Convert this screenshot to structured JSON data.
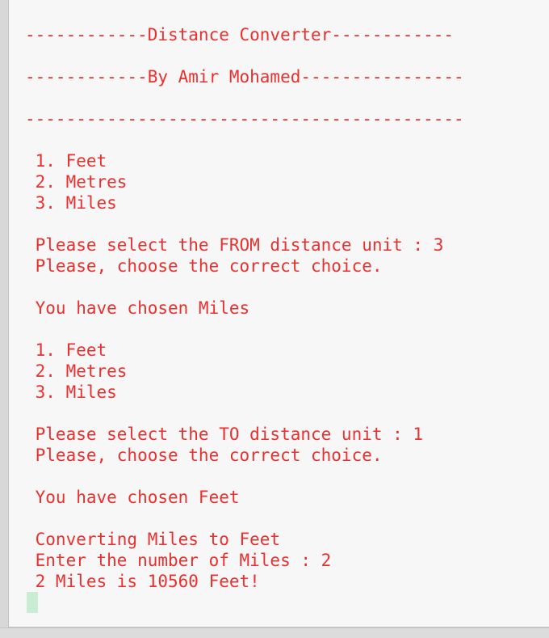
{
  "console": {
    "lines": [
      "------------Distance Converter------------",
      "------------By Amir Mohamed----------------",
      "-------------------------------------------",
      " 1. Feet",
      " 2. Metres",
      " 3. Miles",
      " Please select the FROM distance unit : 3",
      " Please, choose the correct choice.",
      " You have chosen Miles",
      " 1. Feet",
      " 2. Metres",
      " 3. Miles",
      " Please select the TO distance unit : 1",
      " Please, choose the correct choice.",
      " You have chosen Feet",
      " Converting Miles to Feet",
      " Enter the number of Miles : 2",
      " 2 Miles is 10560 Feet!"
    ]
  },
  "colors": {
    "text": "#e8312f",
    "background": "#f7f7f7",
    "cursor": "#c8ecd4"
  }
}
